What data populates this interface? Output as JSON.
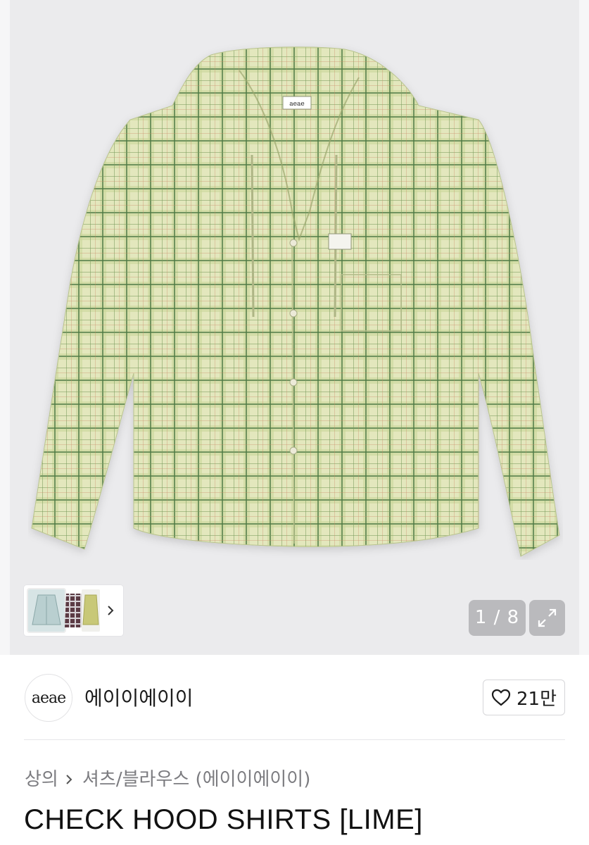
{
  "gallery": {
    "current": "1",
    "total": "8",
    "counter_text": "1 / 8",
    "logo_tag": "aeae"
  },
  "thumbnails": [
    {
      "name": "thumb-lime"
    },
    {
      "name": "thumb-navy"
    },
    {
      "name": "thumb-yellow"
    }
  ],
  "brand": {
    "logo_text": "aeae",
    "name": "에이이에이이",
    "likes": "21만"
  },
  "breadcrumb": {
    "level1": "상의",
    "level2": "셔츠/블라우스 (에이이에이이)"
  },
  "product": {
    "title": "CHECK HOOD SHIRTS [LIME]"
  },
  "colors": {
    "hero_bg": "#ebebed",
    "shirt_base": "#dfe3b4",
    "check_green": "#4e7a45",
    "overlay": "rgba(145,145,150,0.55)"
  },
  "icons": {
    "like": "heart-icon",
    "zoom": "expand-icon",
    "thumb_next": "chevron-right-icon",
    "breadcrumb_sep": "chevron-right-icon"
  }
}
